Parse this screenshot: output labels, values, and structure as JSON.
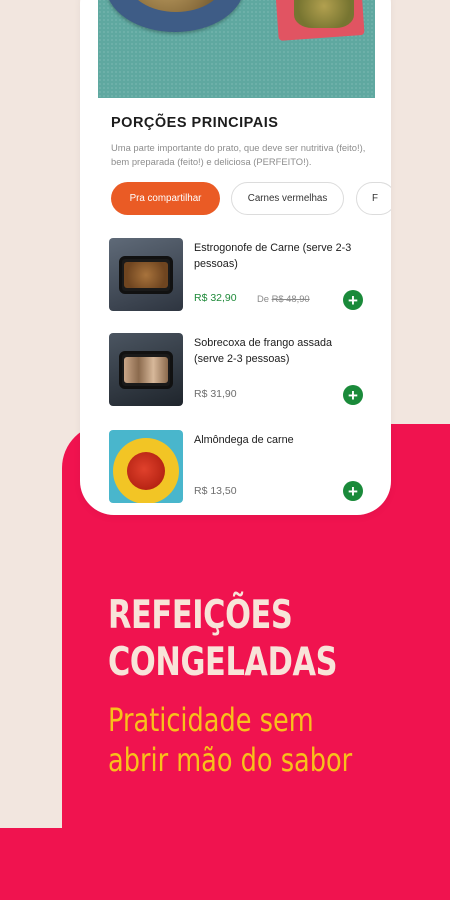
{
  "section": {
    "title": "PORÇÕES PRINCIPAIS",
    "description": "Uma parte importante do prato, que deve ser nutritiva (feito!), bem preparada (feito!) e deliciosa (PERFEITO!)."
  },
  "chips": [
    {
      "label": "Pra compartilhar",
      "active": true
    },
    {
      "label": "Carnes vermelhas",
      "active": false
    },
    {
      "label": "F",
      "active": false
    }
  ],
  "products": [
    {
      "name": "Estrogonofe de Carne (serve 2-3 pessoas)",
      "price": "R$ 32,90",
      "old_price_prefix": "De",
      "old_price": "R$ 48,90",
      "add_symbol": "+"
    },
    {
      "name": "Sobrecoxa de frango assada (serve 2-3 pessoas)",
      "price": "R$ 31,90",
      "add_symbol": "+"
    },
    {
      "name": "Almôndega de carne",
      "price": "R$ 13,50",
      "add_symbol": "+"
    }
  ],
  "promo": {
    "headline_line1": "REFEIÇÕES",
    "headline_line2": "CONGELADAS",
    "subhead_line1": "Praticidade sem",
    "subhead_line2": "abrir mão do sabor"
  },
  "colors": {
    "brand_red": "#f0134f",
    "accent_orange": "#ea5b25",
    "add_green": "#1a8a3a",
    "promo_yellow": "#f8c11a",
    "page_cream": "#f2e6df"
  }
}
